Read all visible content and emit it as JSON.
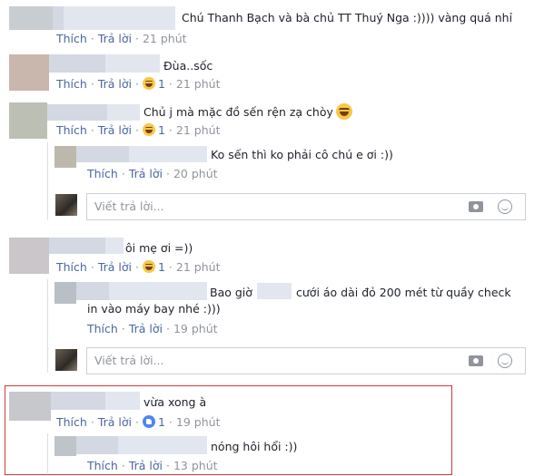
{
  "labels": {
    "like": "Thích",
    "reply": "Trả lời",
    "reply_placeholder": "Viết trả lời..."
  },
  "comments": [
    {
      "text": "Chú Thanh Bạch và bà chủ TT Thuý Nga :)))) vàng quá nhỉ",
      "time": "21 phút",
      "reactions": ""
    },
    {
      "text": "Đùa..sốc",
      "time": "21 phút",
      "reactions": "1"
    },
    {
      "text": "Chủ j mà mặc đồ sến rện zạ chòy",
      "time": "21 phút",
      "reactions": "1",
      "replies": [
        {
          "text": "Ko sến thì ko phải cô chú e ơi :))",
          "time": "20 phút"
        }
      ]
    },
    {
      "text": "ôi mẹ ơi =))",
      "time": "21 phút",
      "reactions": "1",
      "replies": [
        {
          "text_a": "Bao giờ",
          "text_b": "cưới áo dài đỏ 200 mét từ quầy check",
          "text_c": "in vào máy bay nhé :)))",
          "time": "19 phút"
        }
      ]
    },
    {
      "text": "vừa xong à",
      "time": "19 phút",
      "reactions": "1",
      "replies": [
        {
          "text": "nóng hôi hổi :))",
          "time": "13 phút"
        }
      ]
    }
  ],
  "icons": {
    "camera": "camera-icon",
    "emoji": "smiley-icon",
    "laugh": "laugh-reaction-icon",
    "like": "like-reaction-icon"
  },
  "colors": {
    "link": "#4b67a1",
    "muted": "#90949c",
    "highlight": "#d43a3a"
  }
}
